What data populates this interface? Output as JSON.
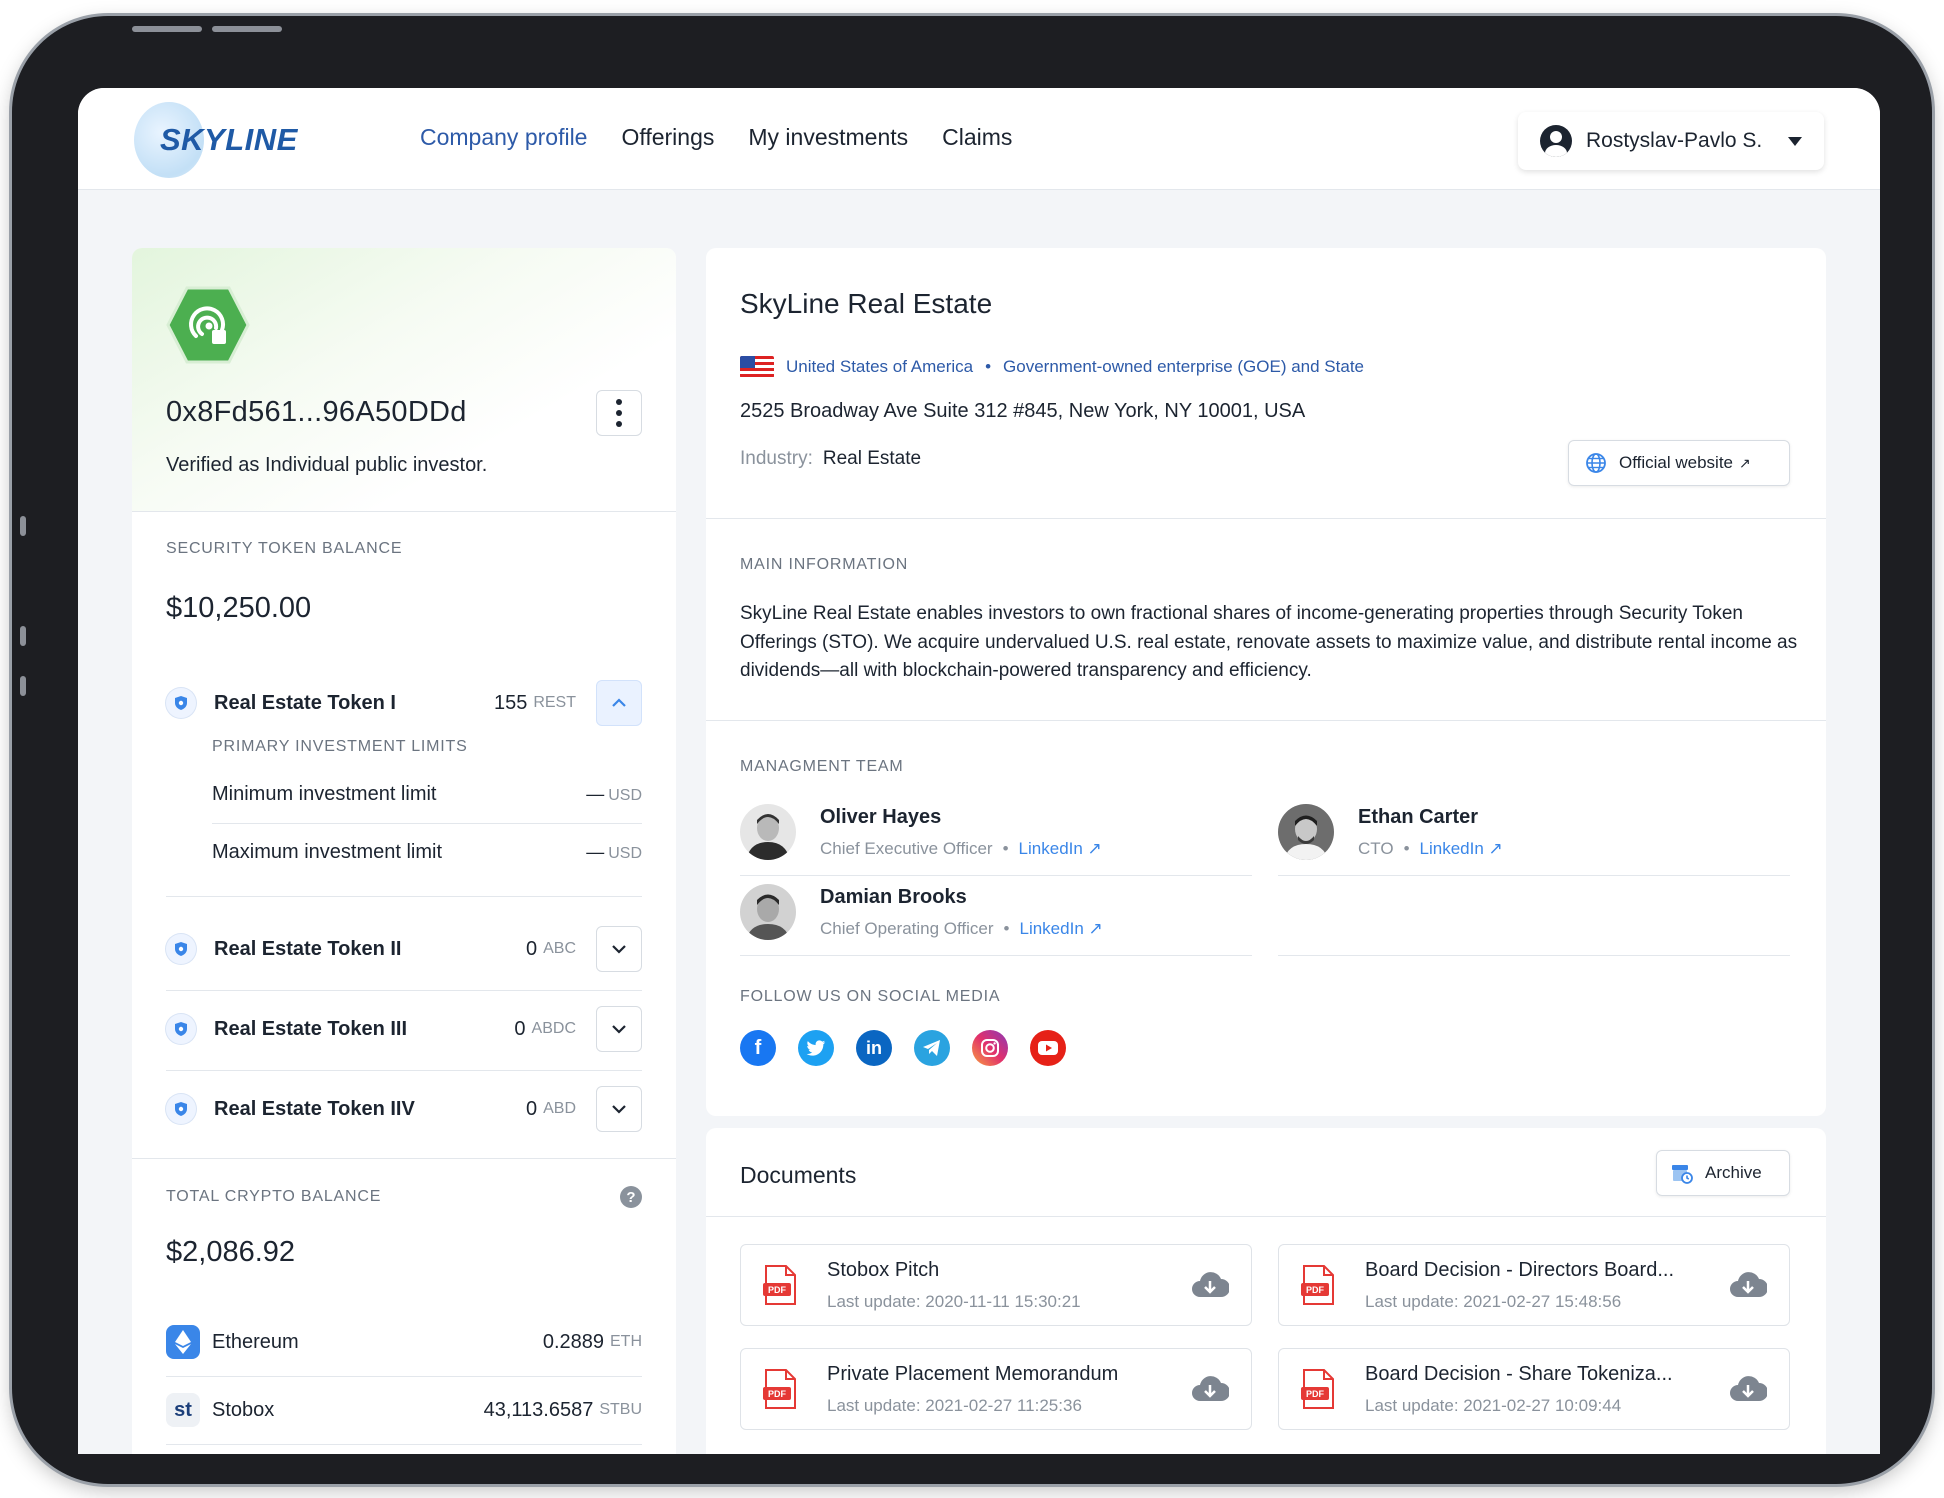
{
  "header": {
    "logo_text": "SKYLINE",
    "nav": [
      "Company profile",
      "Offerings",
      "My investments",
      "Claims"
    ],
    "user_name": "Rostyslav-Pavlo S."
  },
  "wallet": {
    "address": "0x8Fd561...96A50DDd",
    "verified_text": "Verified as Individual public investor."
  },
  "security": {
    "label": "SECURITY TOKEN BALANCE",
    "total": "$10,250.00",
    "tokens": [
      {
        "name": "Real Estate Token I",
        "amount": "155",
        "unit": "REST"
      },
      {
        "name": "Real Estate Token II",
        "amount": "0",
        "unit": "ABC"
      },
      {
        "name": "Real Estate Token III",
        "amount": "0",
        "unit": "ABDC"
      },
      {
        "name": "Real Estate Token IIV",
        "amount": "0",
        "unit": "ABD"
      }
    ],
    "limits_label": "PRIMARY INVESTMENT LIMITS",
    "limits": [
      {
        "label": "Minimum investment limit",
        "value": "—",
        "unit": "USD"
      },
      {
        "label": "Maximum investment limit",
        "value": "—",
        "unit": "USD"
      }
    ]
  },
  "crypto": {
    "label": "TOTAL CRYPTO BALANCE",
    "total": "$2,086.92",
    "items": [
      {
        "name": "Ethereum",
        "amount": "0.2889",
        "unit": "ETH",
        "icon": "ethereum-icon"
      },
      {
        "name": "Stobox",
        "amount": "43,113.6587",
        "unit": "STBU",
        "icon": "stobox-icon",
        "icon_text": "st"
      }
    ]
  },
  "company": {
    "name": "SkyLine Real Estate",
    "country": "United States of America",
    "type": "Government-owned enterprise (GOE) and State",
    "address": "2525 Broadway Ave Suite 312 #845, New York, NY 10001, USA",
    "industry_label": "Industry:",
    "industry": "Real Estate",
    "website_label": "Official website",
    "main_label": "MAIN INFORMATION",
    "description": "SkyLine Real Estate enables investors to own fractional shares of income-generating properties through Security Token Offerings (STO). We acquire undervalued U.S. real estate, renovate assets to maximize value, and distribute rental income as dividends—all with blockchain-powered transparency and efficiency.",
    "team_label": "MANAGMENT TEAM",
    "team": [
      {
        "name": "Oliver Hayes",
        "role": "Chief Executive Officer",
        "link": "LinkedIn"
      },
      {
        "name": "Ethan Carter",
        "role": "CTO",
        "link": "LinkedIn"
      },
      {
        "name": "Damian Brooks",
        "role": "Chief Operating Officer",
        "link": "LinkedIn"
      }
    ],
    "social_label": "FOLLOW US ON SOCIAL MEDIA",
    "socials": [
      "facebook-icon",
      "twitter-icon",
      "linkedin-icon",
      "telegram-icon",
      "instagram-icon",
      "youtube-icon"
    ],
    "social_text": {
      "facebook": "f",
      "linkedin": "in"
    }
  },
  "documents": {
    "title": "Documents",
    "archive_label": "Archive",
    "items": [
      {
        "name": "Stobox Pitch",
        "date": "Last update: 2020-11-11 15:30:21"
      },
      {
        "name": "Board Decision - Directors Board...",
        "date": "Last update: 2021-02-27 15:48:56"
      },
      {
        "name": "Private Placement Memorandum",
        "date": "Last update: 2021-02-27 11:25:36"
      },
      {
        "name": "Board Decision - Share Tokeniza...",
        "date": "Last update: 2021-02-27 10:09:44"
      }
    ]
  },
  "colors": {
    "accent": "#2d5aa8",
    "link": "#3a86e8",
    "brand_green": "#4caf50"
  }
}
